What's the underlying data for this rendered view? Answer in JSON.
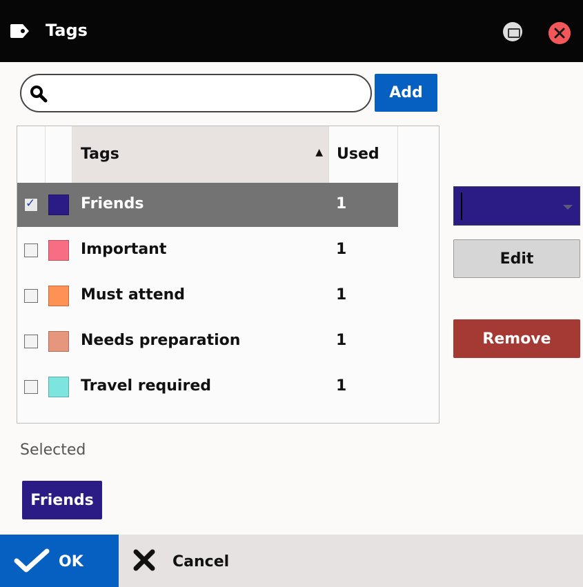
{
  "window": {
    "title": "Tags",
    "icon": "tag-icon",
    "restore_icon": "restore-icon",
    "close_icon": "close-icon"
  },
  "search": {
    "value": "",
    "placeholder": "",
    "icon": "search-icon",
    "add_label": "Add"
  },
  "grid": {
    "columns": [
      "Tags",
      "Used"
    ],
    "sort_indicator": "▲",
    "rows": [
      {
        "name": "Friends",
        "used": "1",
        "checked": true,
        "selected": true,
        "color": "#2b1b84"
      },
      {
        "name": "Important",
        "used": "1",
        "checked": false,
        "selected": false,
        "color": "#f76e84"
      },
      {
        "name": "Must attend",
        "used": "1",
        "checked": false,
        "selected": false,
        "color": "#fe9154"
      },
      {
        "name": "Needs preparation",
        "used": "1",
        "checked": false,
        "selected": false,
        "color": "#e5967c"
      },
      {
        "name": "Travel required",
        "used": "1",
        "checked": false,
        "selected": false,
        "color": "#7de4de"
      }
    ]
  },
  "side": {
    "color_value": "#2b1b84",
    "edit_label": "Edit",
    "remove_label": "Remove"
  },
  "selected_section": {
    "label": "Selected",
    "chips": [
      "Friends"
    ]
  },
  "footer": {
    "ok_label": "OK",
    "cancel_label": "Cancel",
    "ok_icon": "checkmark-icon",
    "cancel_icon": "x-icon"
  },
  "colors": {
    "accent": "#0660c2",
    "danger": "#a53a34",
    "titlebar": "#060606"
  }
}
